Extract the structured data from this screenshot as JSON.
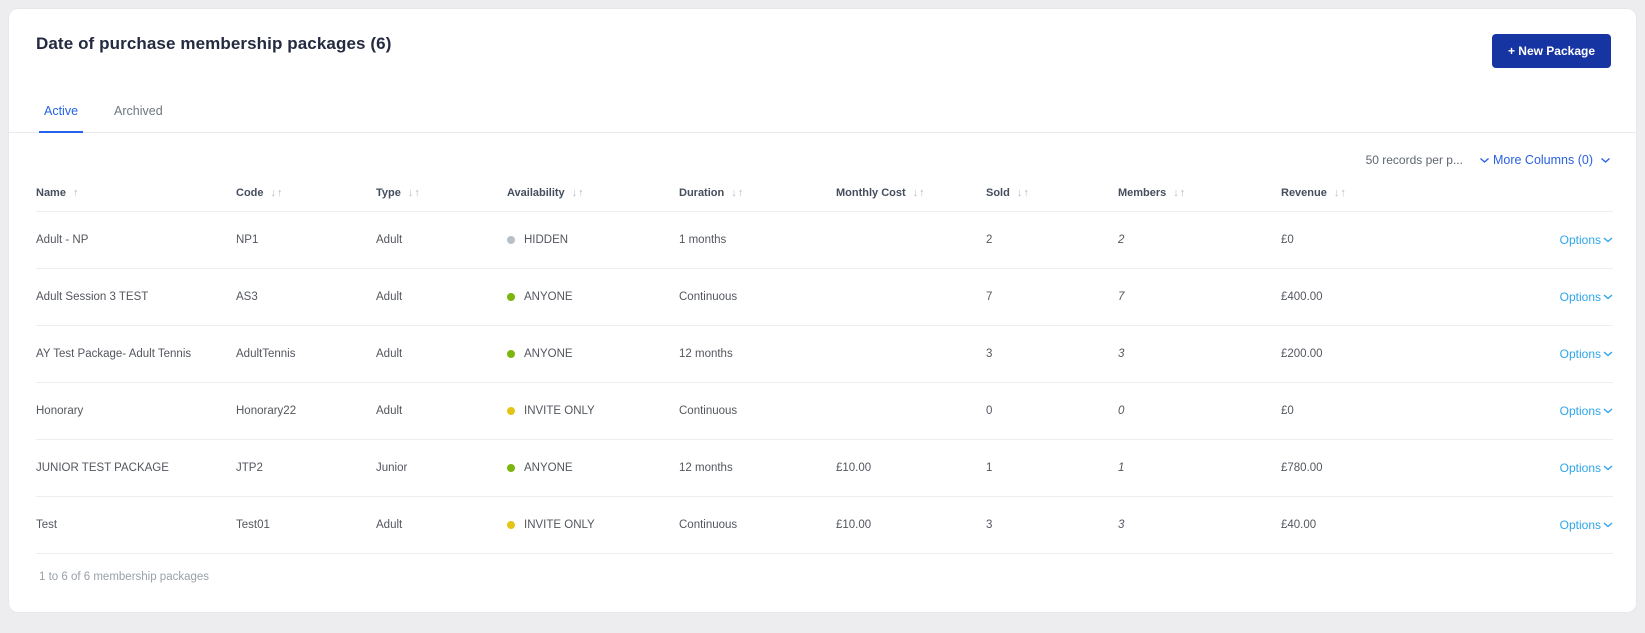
{
  "page": {
    "title": "Date of purchase membership packages (6)",
    "new_package_label": "+ New Package"
  },
  "tabs": [
    {
      "label": "Active",
      "active": true
    },
    {
      "label": "Archived",
      "active": false
    }
  ],
  "controls": {
    "records_per_page": "50 records per p...",
    "more_columns": "More Columns (0)"
  },
  "colors": {
    "accent_blue": "#2563eb",
    "button_blue": "#1734a3",
    "options_blue": "#2ea6ea",
    "availability": {
      "HIDDEN": "#b8bfc7",
      "ANYONE": "#7cb50e",
      "INVITE ONLY": "#e5c418"
    }
  },
  "table": {
    "options_label": "Options",
    "columns": [
      {
        "label": "Name",
        "sort": "asc"
      },
      {
        "label": "Code",
        "sort": "both"
      },
      {
        "label": "Type",
        "sort": "both"
      },
      {
        "label": "Availability",
        "sort": "both"
      },
      {
        "label": "Duration",
        "sort": "both"
      },
      {
        "label": "Monthly Cost",
        "sort": "both"
      },
      {
        "label": "Sold",
        "sort": "both"
      },
      {
        "label": "Members",
        "sort": "both"
      },
      {
        "label": "Revenue",
        "sort": "both"
      },
      {
        "label": "",
        "sort": "none"
      }
    ],
    "rows": [
      {
        "name": "Adult - NP",
        "code": "NP1",
        "type": "Adult",
        "availability": "HIDDEN",
        "duration": "1 months",
        "monthly_cost": "",
        "sold": "2",
        "members": "2",
        "revenue": "£0"
      },
      {
        "name": "Adult Session 3 TEST",
        "code": "AS3",
        "type": "Adult",
        "availability": "ANYONE",
        "duration": "Continuous",
        "monthly_cost": "",
        "sold": "7",
        "members": "7",
        "revenue": "£400.00"
      },
      {
        "name": "AY Test Package- Adult Tennis",
        "code": "AdultTennis",
        "type": "Adult",
        "availability": "ANYONE",
        "duration": "12 months",
        "monthly_cost": "",
        "sold": "3",
        "members": "3",
        "revenue": "£200.00"
      },
      {
        "name": "Honorary",
        "code": "Honorary22",
        "type": "Adult",
        "availability": "INVITE ONLY",
        "duration": "Continuous",
        "monthly_cost": "",
        "sold": "0",
        "members": "0",
        "revenue": "£0"
      },
      {
        "name": "JUNIOR TEST PACKAGE",
        "code": "JTP2",
        "type": "Junior",
        "availability": "ANYONE",
        "duration": "12 months",
        "monthly_cost": "£10.00",
        "sold": "1",
        "members": "1",
        "revenue": "£780.00"
      },
      {
        "name": "Test",
        "code": "Test01",
        "type": "Adult",
        "availability": "INVITE ONLY",
        "duration": "Continuous",
        "monthly_cost": "£10.00",
        "sold": "3",
        "members": "3",
        "revenue": "£40.00"
      }
    ],
    "footer": "1 to 6 of 6 membership packages"
  }
}
